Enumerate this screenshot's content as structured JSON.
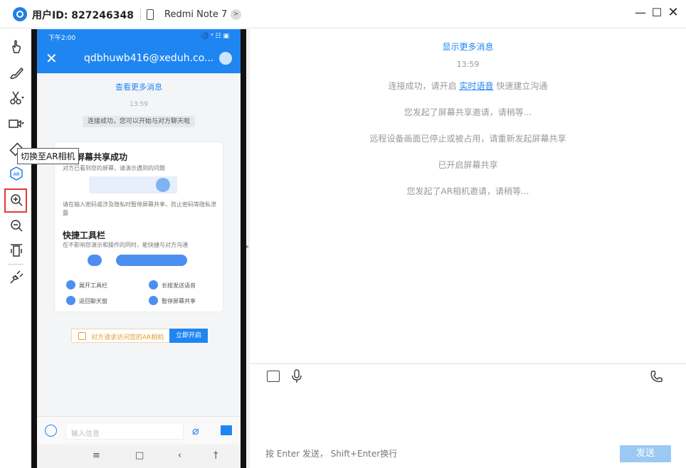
{
  "titlebar": {
    "user_id": "用户ID: 827246348",
    "device": "Redmi Note 7"
  },
  "tooltip": "切换至AR相机",
  "phone": {
    "status_time": "下午2:00",
    "status_right": "🔵 ᵃ ☷ ▣",
    "chat_title": "qdbhuwb416@xeduh.co...",
    "view_more": "查看更多消息",
    "time": "13:59",
    "connected": "连接成功，您可以开始与对方聊天啦",
    "card": {
      "share_title": "屏幕共享成功",
      "share_desc": "对方已看到您的屏幕，请演示遇到的问题",
      "privacy": "请在输入密码或涉及隐私时暂停屏幕共享，防止密码等隐私泄露",
      "tools_title": "快捷工具栏",
      "tools_desc": "在不影响您演示和操作的同时，能快捷与对方沟通",
      "f1": "展开工具栏",
      "f2": "长按发送语音",
      "f3": "返回聊天窗",
      "f4": "暂停屏幕共享"
    },
    "ar_request": "对方请求访问您的AR相机",
    "ar_open": "立即开启",
    "input_placeholder": "输入信息"
  },
  "chat": {
    "show_more": "显示更多消息",
    "time": "13:59",
    "connected_pre": "连接成功，请开启",
    "connected_link": "实时语音",
    "connected_post": "快速建立沟通",
    "share_invite": "您发起了屏幕共享邀请，请稍等...",
    "remote_stopped": "远程设备画面已停止或被占用，请重新发起屏幕共享",
    "share_started": "已开启屏幕共享",
    "ar_invite": "您发起了AR相机邀请，请稍等..."
  },
  "compose": {
    "hint": "按 Enter 发送，  Shift+Enter换行",
    "send": "发送"
  }
}
